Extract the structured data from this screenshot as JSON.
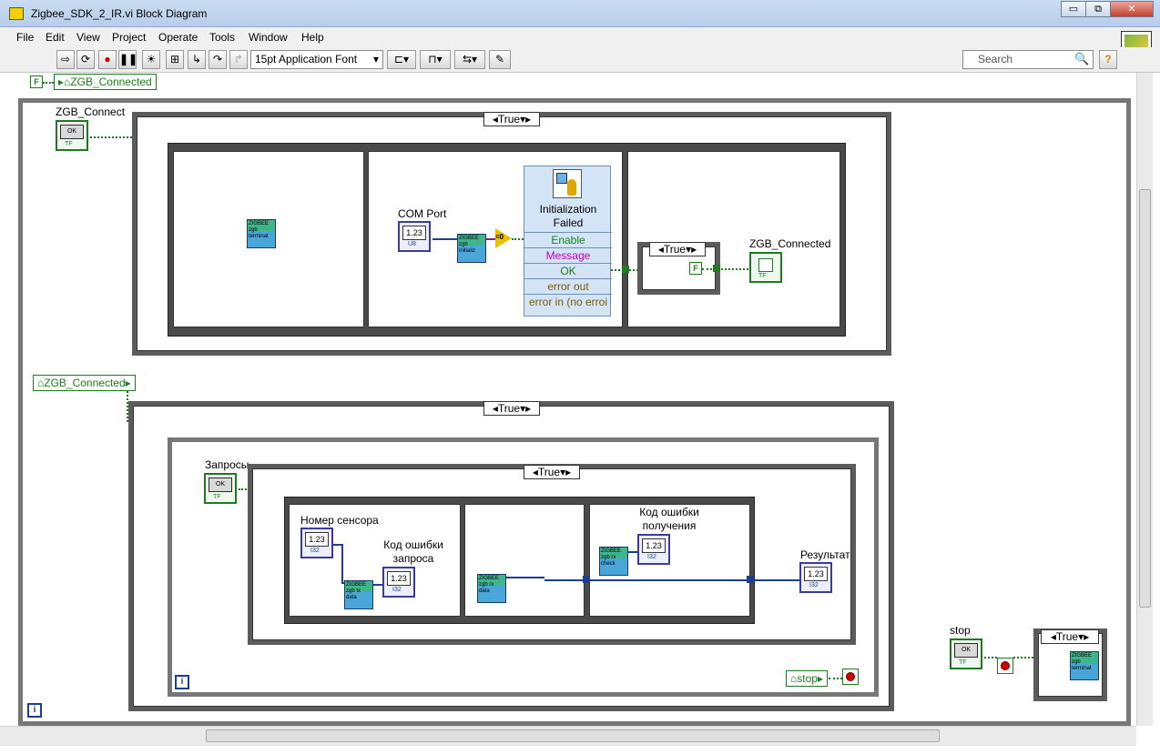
{
  "window": {
    "title": "Zigbee_SDK_2_IR.vi Block Diagram",
    "controls": {
      "minimize": "▭",
      "restore": "⧉",
      "close": "✕"
    }
  },
  "menu": [
    "File",
    "Edit",
    "View",
    "Project",
    "Operate",
    "Tools",
    "Window",
    "Help"
  ],
  "toolbar": {
    "font": "15pt Application Font",
    "search_placeholder": "Search",
    "help_glyph": "?"
  },
  "diagram": {
    "false_const": "F",
    "top_var": "ZGB_Connected",
    "mid_var": "ZGB_Connected",
    "zgb_connect_label": "ZGB_Connect",
    "ok": "OK",
    "tf": "TF",
    "case_true": "True",
    "com_port_label": "COM Port",
    "num_display": "1.23",
    "num_type_u8": "U8",
    "num_type_i32": "I32",
    "eq0": "=0",
    "dialog": {
      "title": "Initialization Failed",
      "rows": [
        "Enable",
        "Message",
        "OK",
        "error out",
        "error in (no erroi"
      ]
    },
    "zgb_connected_label": "ZGB_Connected",
    "subvi": {
      "terminate": "ZIGBEE zgb terminat",
      "initialize": "ZIGBEE zgb initializ",
      "tx": "ZIGBEE zgb tx data",
      "rx": "ZIGBEE zgb rx data",
      "check": "ZIGBEE zgb rx check"
    },
    "zaprosy_label": "Запросы",
    "sensor_label": "Номер сенсора",
    "req_err_label": "Код ошибки запроса",
    "recv_err_label": "Код ошибки получения",
    "result_label": "Результат",
    "stop_local": "stop",
    "stop_label": "stop",
    "iter": "i"
  },
  "colors": {
    "bool": "#1b7f1b",
    "numeric": "#1e3f8f",
    "stop": "#d00000"
  }
}
